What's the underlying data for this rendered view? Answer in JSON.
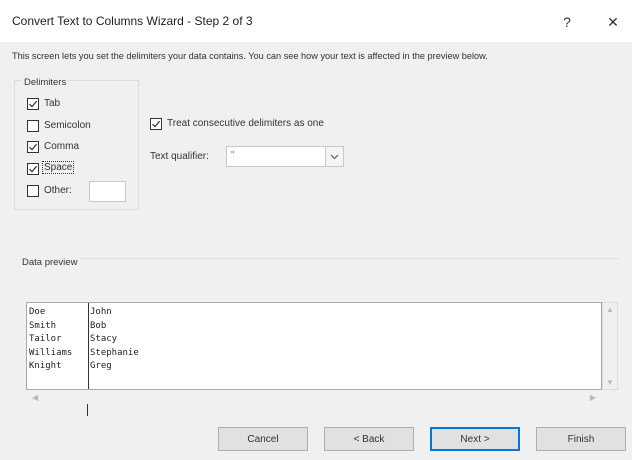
{
  "window": {
    "title": "Convert Text to Columns Wizard - Step 2 of 3",
    "help_glyph": "?",
    "close_glyph": "✕"
  },
  "description": "This screen lets you set the delimiters your data contains.  You can see how your text is affected in the preview below.",
  "delimiters": {
    "label": "Delimiters",
    "items": [
      {
        "label": "Tab",
        "checked": true
      },
      {
        "label": "Semicolon",
        "checked": false
      },
      {
        "label": "Comma",
        "checked": true
      },
      {
        "label": "Space",
        "checked": true
      },
      {
        "label": "Other:",
        "checked": false
      }
    ],
    "other_value": ""
  },
  "consecutive": {
    "label": "Treat consecutive delimiters as one",
    "checked": true
  },
  "qualifier": {
    "label": "Text qualifier:",
    "value": "\""
  },
  "preview": {
    "label": "Data preview",
    "col1": [
      "Doe",
      "Smith",
      "Tailor",
      "Williams",
      "Knight"
    ],
    "col2": [
      "John",
      "Bob",
      "Stacy",
      "Stephanie",
      "Greg"
    ]
  },
  "buttons": {
    "cancel": "Cancel",
    "back": "< Back",
    "next": "Next >",
    "finish": "Finish"
  }
}
